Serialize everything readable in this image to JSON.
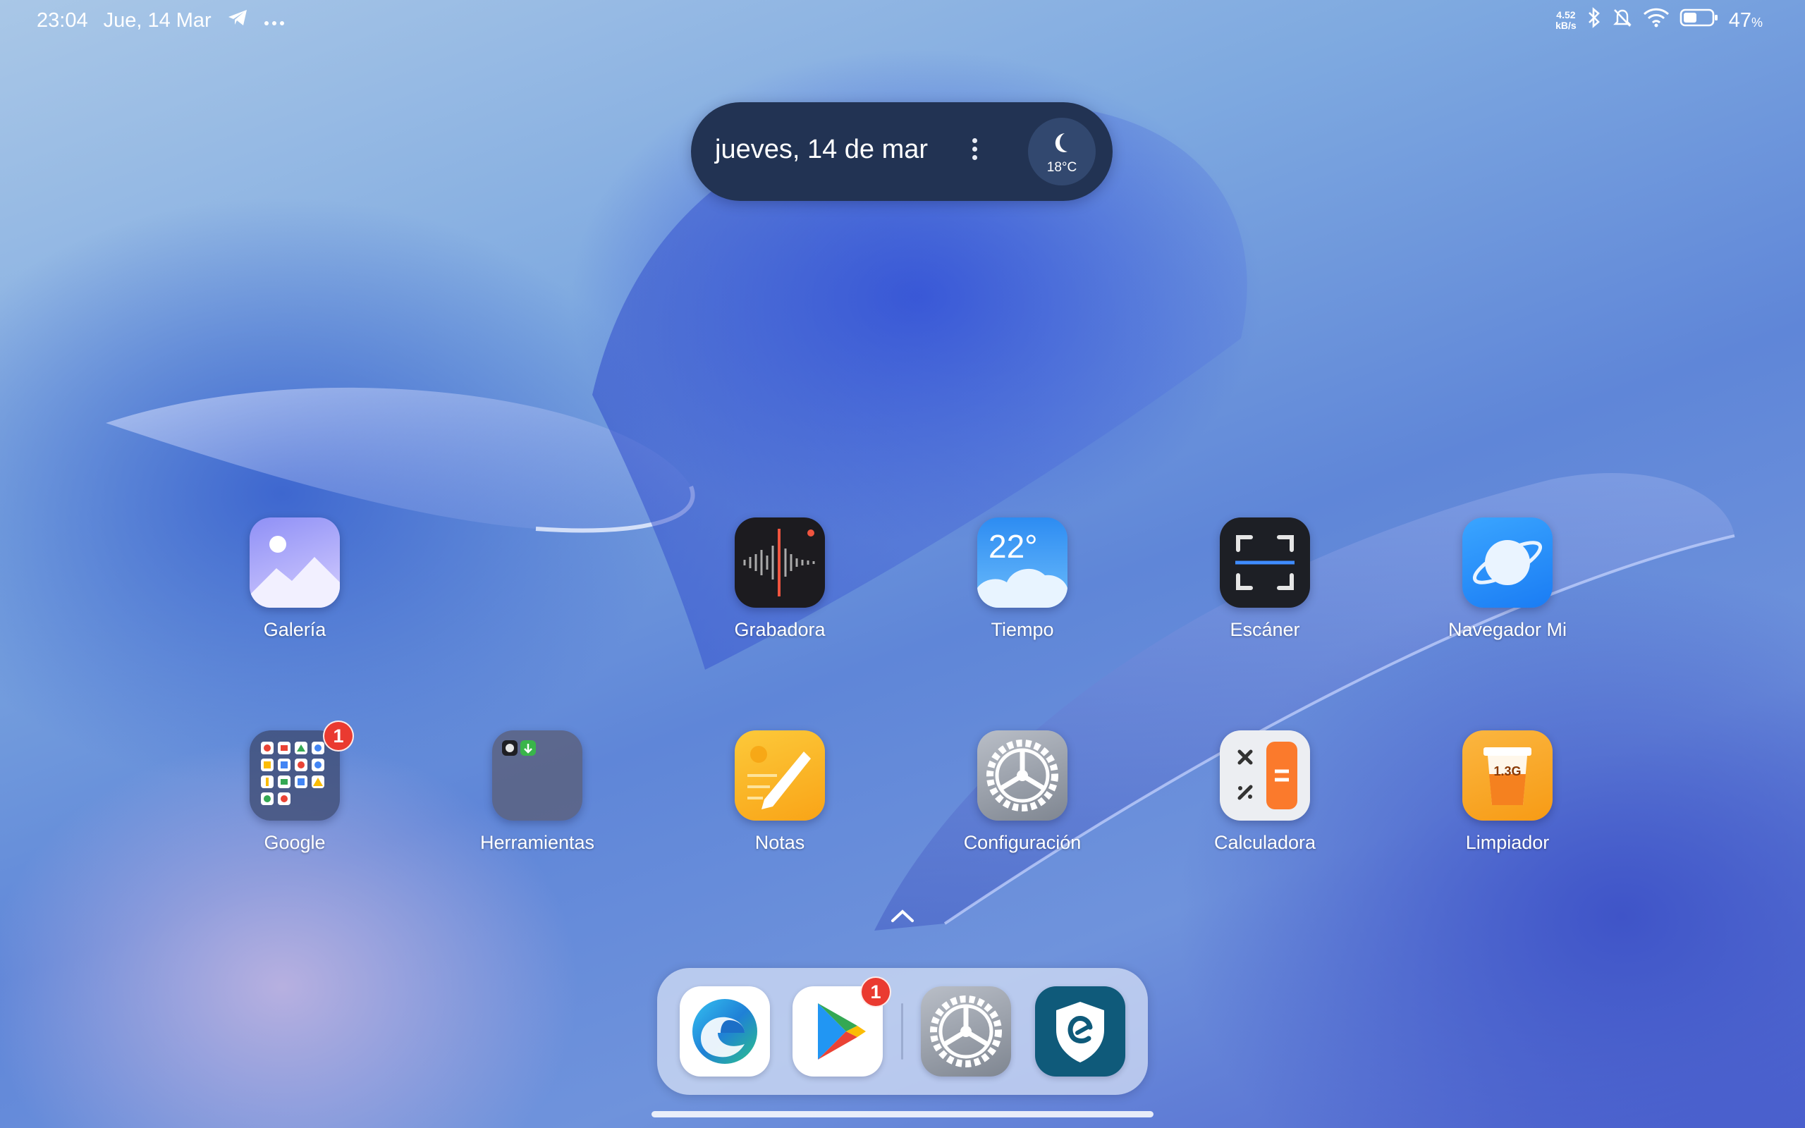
{
  "status_bar": {
    "time": "23:04",
    "date": "Jue, 14 Mar",
    "net_speed_value": "4.52",
    "net_speed_unit": "kB/s",
    "battery_percent": "47",
    "battery_unit": "%",
    "battery_level": 0.47,
    "icons": [
      "telegram-icon",
      "more-dots-icon",
      "bluetooth-icon",
      "bell-muted-icon",
      "wifi-icon",
      "battery-icon"
    ]
  },
  "widget": {
    "date_text": "jueves, 14 de mar",
    "temperature": "18°C",
    "weather_icon": "moon-icon"
  },
  "apps_row1": [
    {
      "label": "Galería",
      "icon": "gallery-icon"
    },
    {
      "label": "Grabadora",
      "icon": "recorder-icon"
    },
    {
      "label": "Tiempo",
      "icon": "weather-icon",
      "icon_text": "22°"
    },
    {
      "label": "Escáner",
      "icon": "scanner-icon"
    },
    {
      "label": "Navegador Mi",
      "icon": "browser-planet-icon"
    }
  ],
  "apps_row2": [
    {
      "label": "Google",
      "icon": "google-folder-icon",
      "badge": "1"
    },
    {
      "label": "Herramientas",
      "icon": "tools-folder-icon"
    },
    {
      "label": "Notas",
      "icon": "notes-icon"
    },
    {
      "label": "Configuración",
      "icon": "settings-gear-icon"
    },
    {
      "label": "Calculadora",
      "icon": "calculator-icon"
    },
    {
      "label": "Limpiador",
      "icon": "cleaner-icon",
      "icon_text": "1.3G"
    }
  ],
  "dock": {
    "apps": [
      {
        "name": "edge",
        "icon": "edge-browser-icon"
      },
      {
        "name": "play-store",
        "icon": "play-store-icon",
        "badge": "1"
      },
      {
        "name": "settings",
        "icon": "settings-gear-icon"
      },
      {
        "name": "security",
        "icon": "security-shield-icon"
      }
    ]
  },
  "colors": {
    "widget_bg": "#223353",
    "badge": "#ea3a30",
    "notes_yellow": "#fbb21e",
    "cleaner_orange": "#f7a21b"
  }
}
